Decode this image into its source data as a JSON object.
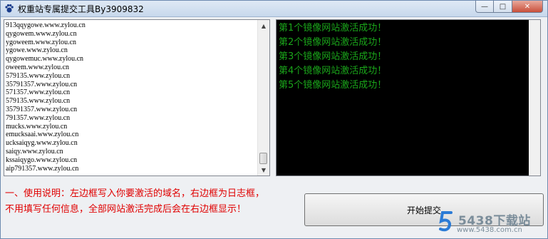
{
  "window": {
    "title": "权重站专属提交工具By3909832",
    "buttons": {
      "minimize": "—",
      "maximize": "□",
      "close": "✕"
    }
  },
  "domain_list": [
    "913qqygowe.www.zylou.cn",
    "qygowem.www.zylou.cn",
    "ygoweem.www.zylou.cn",
    "ygowe.www.zylou.cn",
    "qygowemuc.www.zylou.cn",
    "oweem.www.zylou.cn",
    "579135.www.zylou.cn",
    "35791357.www.zylou.cn",
    "571357.www.zylou.cn",
    "579135.www.zylou.cn",
    "35791357.www.zylou.cn",
    "791357.www.zylou.cn",
    "mucks.www.zylou.cn",
    "emucksaai.www.zylou.cn",
    "ucksaiqyg.www.zylou.cn",
    "saiqy.www.zylou.cn",
    "kssaiqygo.www.zylou.cn",
    "aip791357.www.zylou.cn"
  ],
  "log_lines": [
    "第1个镜像网站激活成功！",
    "第2个镜像网站激活成功！",
    "第3个镜像网站激活成功！",
    "第4个镜像网站激活成功！",
    "第5个镜像网站激活成功！"
  ],
  "instructions": {
    "line1": "一、使用说明：左边框写入你要激活的域名，右边框为日志框，",
    "line2": "不用填写任何信息，全部网站激活完成后会在右边框显示！"
  },
  "start_button": {
    "label": "开始提交"
  },
  "watermark": {
    "brand": "5438下载站",
    "url": "www.5438.com.cn"
  },
  "colors": {
    "log_text": "#1aa51a",
    "instructions_text": "#e00000",
    "log_bg": "#000000"
  }
}
